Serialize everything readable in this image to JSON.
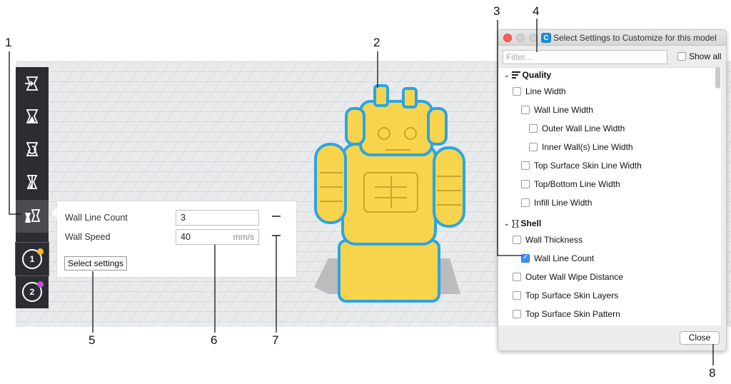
{
  "sidebar": {
    "tools": [
      {
        "name": "move-tool"
      },
      {
        "name": "scale-tool"
      },
      {
        "name": "rotate-tool"
      },
      {
        "name": "mirror-tool"
      },
      {
        "name": "per-model-settings-tool"
      }
    ],
    "extruders": [
      {
        "number": "1",
        "color": "#f5c21b"
      },
      {
        "number": "2",
        "color": "#c04fd8"
      }
    ]
  },
  "per_model_panel": {
    "wall_line_count_label": "Wall Line Count",
    "wall_line_count_value": "3",
    "wall_speed_label": "Wall Speed",
    "wall_speed_value": "40",
    "wall_speed_unit": "mm/s",
    "select_settings_label": "Select settings"
  },
  "dialog": {
    "title": "Select Settings to Customize for this model",
    "app_icon": "C",
    "filter_placeholder": "Filter...",
    "show_all_label": "Show all",
    "close_label": "Close",
    "categories": {
      "quality": {
        "label": "Quality",
        "items": [
          {
            "label": "Line Width",
            "checked": false
          },
          {
            "label": "Wall Line Width",
            "checked": false
          },
          {
            "label": "Outer Wall Line Width",
            "checked": false
          },
          {
            "label": "Inner Wall(s) Line Width",
            "checked": false
          },
          {
            "label": "Top Surface Skin Line Width",
            "checked": false
          },
          {
            "label": "Top/Bottom Line Width",
            "checked": false
          },
          {
            "label": "Infill Line Width",
            "checked": false
          }
        ]
      },
      "shell": {
        "label": "Shell",
        "items": [
          {
            "label": "Wall Thickness",
            "checked": false
          },
          {
            "label": "Wall Line Count",
            "checked": true
          },
          {
            "label": "Outer Wall Wipe Distance",
            "checked": false
          },
          {
            "label": "Top Surface Skin Layers",
            "checked": false
          },
          {
            "label": "Top Surface Skin Pattern",
            "checked": false
          }
        ]
      }
    }
  },
  "callouts": [
    "1",
    "2",
    "3",
    "4",
    "5",
    "6",
    "7",
    "8"
  ],
  "colors": {
    "model_yellow": "#f7d44c",
    "model_outline": "#2aa5e3",
    "toolbar_bg": "#2b2d31",
    "checkbox_blue": "#3d8ff0"
  }
}
